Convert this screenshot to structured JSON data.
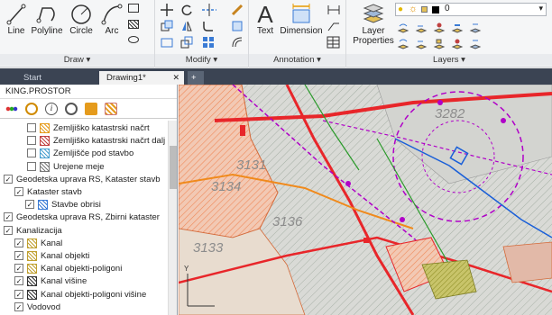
{
  "ribbon": {
    "draw": {
      "title": "Draw",
      "line": "Line",
      "polyline": "Polyline",
      "circle": "Circle",
      "arc": "Arc"
    },
    "modify": {
      "title": "Modify"
    },
    "annotation": {
      "title": "Annotation",
      "text": "Text",
      "dimension": "Dimension"
    },
    "layers": {
      "title": "Layers",
      "layer_properties_1": "Layer",
      "layer_properties_2": "Properties",
      "current_layer": "0"
    }
  },
  "tabs": {
    "start": "Start",
    "drawing": "Drawing1*",
    "add": "+"
  },
  "panel": {
    "title": "KING.PROSTOR",
    "tree": [
      {
        "label": "Zemljiško katastrski načrt",
        "checked": false
      },
      {
        "label": "Zemljiško katastrski načrt dalj",
        "checked": false
      },
      {
        "label": "Zemljišče pod stavbo",
        "checked": false
      },
      {
        "label": "Urejene meje",
        "checked": false
      },
      {
        "label": "Geodetska uprava RS, Kataster stavb",
        "checked": true
      },
      {
        "label": "Kataster stavb",
        "checked": true
      },
      {
        "label": "Stavbe obrisi",
        "checked": true
      },
      {
        "label": "Geodetska uprava RS, Zbirni kataster",
        "checked": true
      },
      {
        "label": "Kanalizacija",
        "checked": true
      },
      {
        "label": "Kanal",
        "checked": true
      },
      {
        "label": "Kanal objekti",
        "checked": true
      },
      {
        "label": "Kanal objekti-poligoni",
        "checked": true
      },
      {
        "label": "Kanal višine",
        "checked": true
      },
      {
        "label": "Kanal objekti-poligoni višine",
        "checked": true
      },
      {
        "label": "Vodovod",
        "checked": true
      }
    ]
  },
  "map": {
    "parcels": [
      "3134",
      "3133",
      "3136",
      "3282",
      "3131"
    ],
    "accent": "#e8262a",
    "magenta": "#b000c8"
  }
}
